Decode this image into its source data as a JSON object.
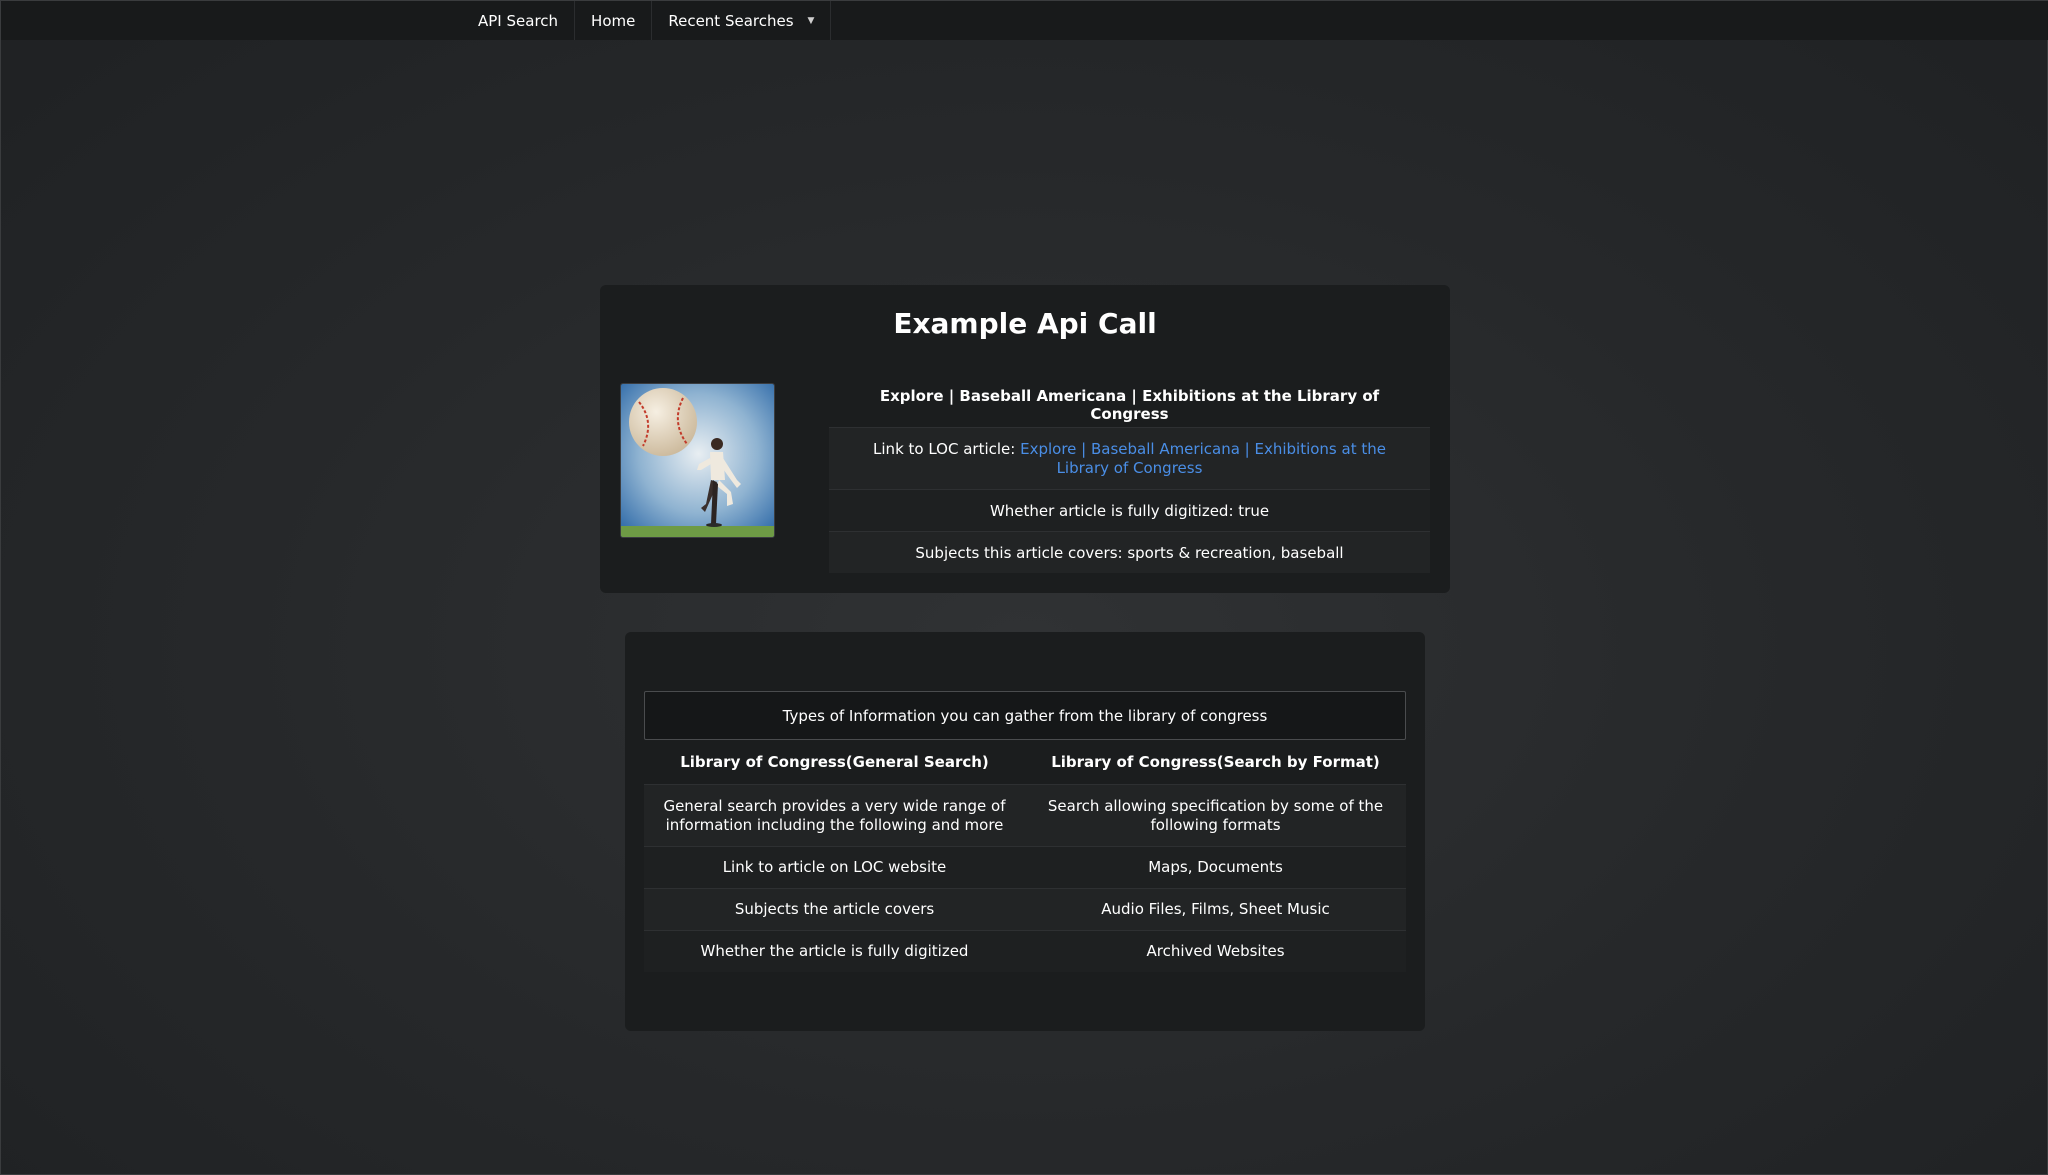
{
  "nav": {
    "brand": "API Search",
    "home": "Home",
    "recent": "Recent Searches"
  },
  "example": {
    "title": "Example Api Call",
    "article_title": "Explore  | Baseball Americana  | Exhibitions at the Library of Congress",
    "link_label": "Link to LOC article: ",
    "link_text": "Explore  | Baseball Americana  | Exhibitions at the Library of Congress",
    "digitized": "Whether article is fully digitized: true",
    "subjects": "Subjects this article covers: sports & recreation, baseball"
  },
  "types": {
    "caption": "Types of Information you can gather from the library of congress",
    "headers": [
      "Library of Congress(General Search)",
      "Library of Congress(Search by Format)"
    ],
    "rows": [
      [
        "General search provides a very wide range of information including the following and more",
        "Search allowing specification by some of the following formats"
      ],
      [
        "Link to article on LOC website",
        "Maps, Documents"
      ],
      [
        "Subjects the article covers",
        "Audio Files, Films, Sheet Music"
      ],
      [
        "Whether the article is fully digitized",
        "Archived Websites"
      ]
    ]
  },
  "icons": {
    "dropdown": "chevron-down-icon"
  }
}
